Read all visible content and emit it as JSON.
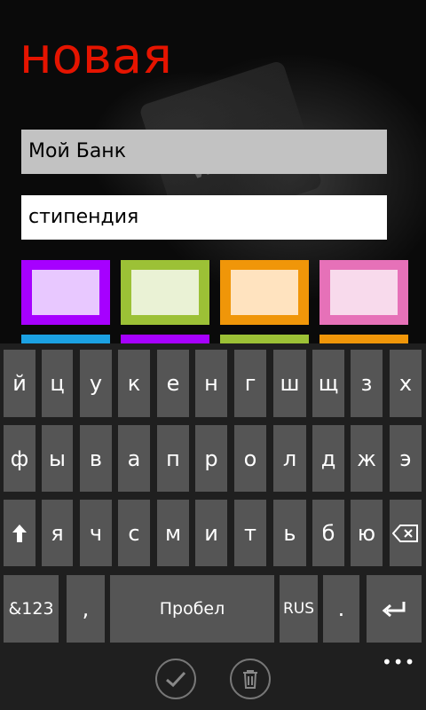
{
  "page": {
    "title": "новая"
  },
  "form": {
    "name_value": "Мой Банк",
    "category_value": "стипендия"
  },
  "colors": {
    "accent": "#e51400",
    "swatches": [
      {
        "outer": "#a600ff",
        "inner": "#e8c8ff"
      },
      {
        "outer": "#9cc136",
        "inner": "#eaf2d5"
      },
      {
        "outer": "#f09609",
        "inner": "#ffe3bf"
      },
      {
        "outer": "#e671b8",
        "inner": "#f8daec"
      }
    ],
    "second_row": [
      "#1ba1e2",
      "#a600ff",
      "#9cc136",
      "#f09609"
    ]
  },
  "keyboard": {
    "row1": [
      "й",
      "ц",
      "у",
      "к",
      "е",
      "н",
      "г",
      "ш",
      "щ",
      "з",
      "х"
    ],
    "row2": [
      "ф",
      "ы",
      "в",
      "а",
      "п",
      "р",
      "о",
      "л",
      "д",
      "ж",
      "э"
    ],
    "row3": [
      "я",
      "ч",
      "с",
      "м",
      "и",
      "т",
      "ь",
      "б",
      "ю"
    ],
    "shift_icon": "shift-arrow-icon",
    "backspace_icon": "backspace-icon",
    "symbols_label": "&123",
    "comma_label": ",",
    "space_label": "Пробел",
    "language_label": "RUS",
    "period_label": ".",
    "enter_icon": "enter-icon"
  },
  "appbar": {
    "ok_icon": "check-icon",
    "delete_icon": "trash-icon",
    "more_label": "•••"
  }
}
